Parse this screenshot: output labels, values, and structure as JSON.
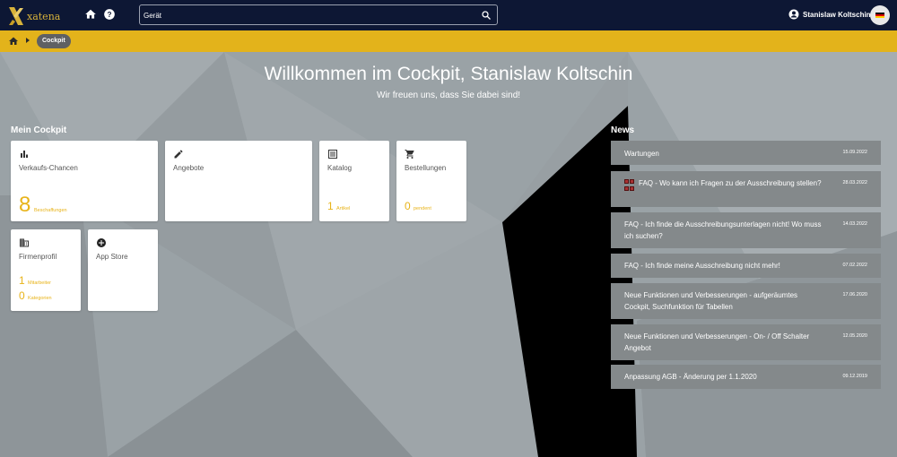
{
  "header": {
    "logo_text": "xatena",
    "search": {
      "value": "Gerät",
      "placeholder": ""
    },
    "user_name": "Stanislaw Koltschin",
    "language": "de"
  },
  "breadcrumb": {
    "current": "Cockpit"
  },
  "welcome": {
    "title": "Willkommen im Cockpit, Stanislaw Koltschin",
    "subtitle": "Wir freuen uns, dass Sie dabei sind!"
  },
  "cockpit": {
    "heading": "Mein Cockpit",
    "cards": [
      {
        "id": "verkaufs-chancen",
        "icon": "bar-chart-icon",
        "title": "Verkaufs-Chancen",
        "value": "8",
        "unit": "Beschaffungen"
      },
      {
        "id": "angebote",
        "icon": "pencil-icon",
        "title": "Angebote"
      },
      {
        "id": "katalog",
        "icon": "catalog-icon",
        "title": "Katalog",
        "value": "1",
        "unit": "Artikel"
      },
      {
        "id": "bestellungen",
        "icon": "cart-icon",
        "title": "Bestellungen",
        "value": "0",
        "unit": "pendent"
      },
      {
        "id": "firmenprofil",
        "icon": "building-icon",
        "title": "Firmenprofil",
        "value": "1",
        "unit": "Mitarbeiter",
        "value2": "0",
        "unit2": "Kategorien"
      },
      {
        "id": "app-store",
        "icon": "add-circle-icon",
        "title": "App Store"
      }
    ]
  },
  "news": {
    "heading": "News",
    "items": [
      {
        "text": "Wartungen",
        "date": "15.09.2022"
      },
      {
        "text": "FAQ - Wo kann ich Fragen zu der Ausschreibung stellen?",
        "date": "28.03.2022"
      },
      {
        "text": "FAQ - Ich finde die Ausschreibungsunterlagen nicht! Wo muss ich suchen?",
        "date": "14.03.2022"
      },
      {
        "text": "FAQ - Ich finde meine Ausschreibung nicht mehr!",
        "date": "07.02.2022"
      },
      {
        "text": "Neue Funktionen und Verbesserungen - aufgeräumtes Cockpit, Suchfunktion für Tabellen",
        "date": "17.06.2020"
      },
      {
        "text": "Neue Funktionen und Verbesserungen - On- / Off Schalter Angebot",
        "date": "12.05.2020"
      },
      {
        "text": "Anpassung AGB - Änderung per 1.1.2020",
        "date": "09.12.2019"
      }
    ]
  },
  "colors": {
    "topbar": "#0d1734",
    "accent": "#e3b31b",
    "background": "#9aa2a6",
    "news_item": "#84898b"
  }
}
